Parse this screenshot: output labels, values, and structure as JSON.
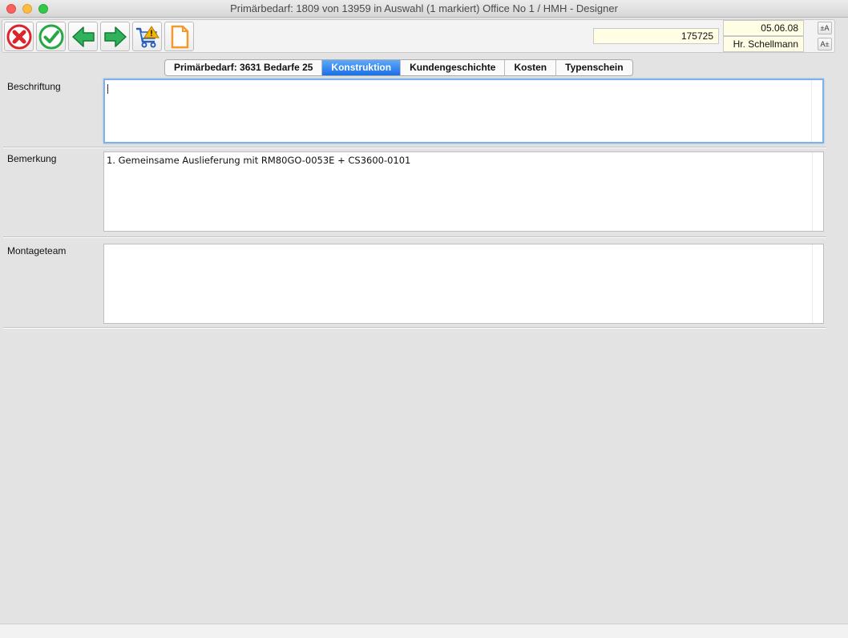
{
  "window": {
    "title": "Primärbedarf: 1809 von 13959 in Auswahl  (1 markiert) Office No 1 /  HMH - Designer"
  },
  "toolbar": {
    "buttons": [
      {
        "icon": "cancel-icon",
        "color": "#d9262c"
      },
      {
        "icon": "checkmark-icon",
        "color": "#28a745"
      },
      {
        "icon": "arrow-left-icon",
        "color": "#1f9a45"
      },
      {
        "icon": "arrow-right-icon",
        "color": "#1f9a45"
      },
      {
        "icon": "cart-warning-icon",
        "color": "#f5b400"
      },
      {
        "icon": "document-icon",
        "color": "#f39a2e"
      }
    ],
    "number_value": "175725",
    "date_value": "05.06.08",
    "user_value": "Hr. Schellmann",
    "font_up_label": "±A",
    "font_down_label": "A±"
  },
  "tabs": [
    {
      "label": "Primärbedarf: 3631 Bedarfe 25",
      "active": false
    },
    {
      "label": "Konstruktion",
      "active": true
    },
    {
      "label": "Kundengeschichte",
      "active": false
    },
    {
      "label": "Kosten",
      "active": false
    },
    {
      "label": "Typenschein",
      "active": false
    }
  ],
  "form": {
    "beschriftung": {
      "label": "Beschriftung",
      "value": ""
    },
    "bemerkung": {
      "label": "Bemerkung",
      "value": "1. Gemeinsame Auslieferung mit RM80GO-0053E + CS3600-0101"
    },
    "montageteam": {
      "label": "Montageteam",
      "value": ""
    }
  },
  "colors": {
    "active_tab": "#1a6fe6",
    "field_bg": "#fffde3",
    "focus_ring": "#7fb0ea"
  }
}
